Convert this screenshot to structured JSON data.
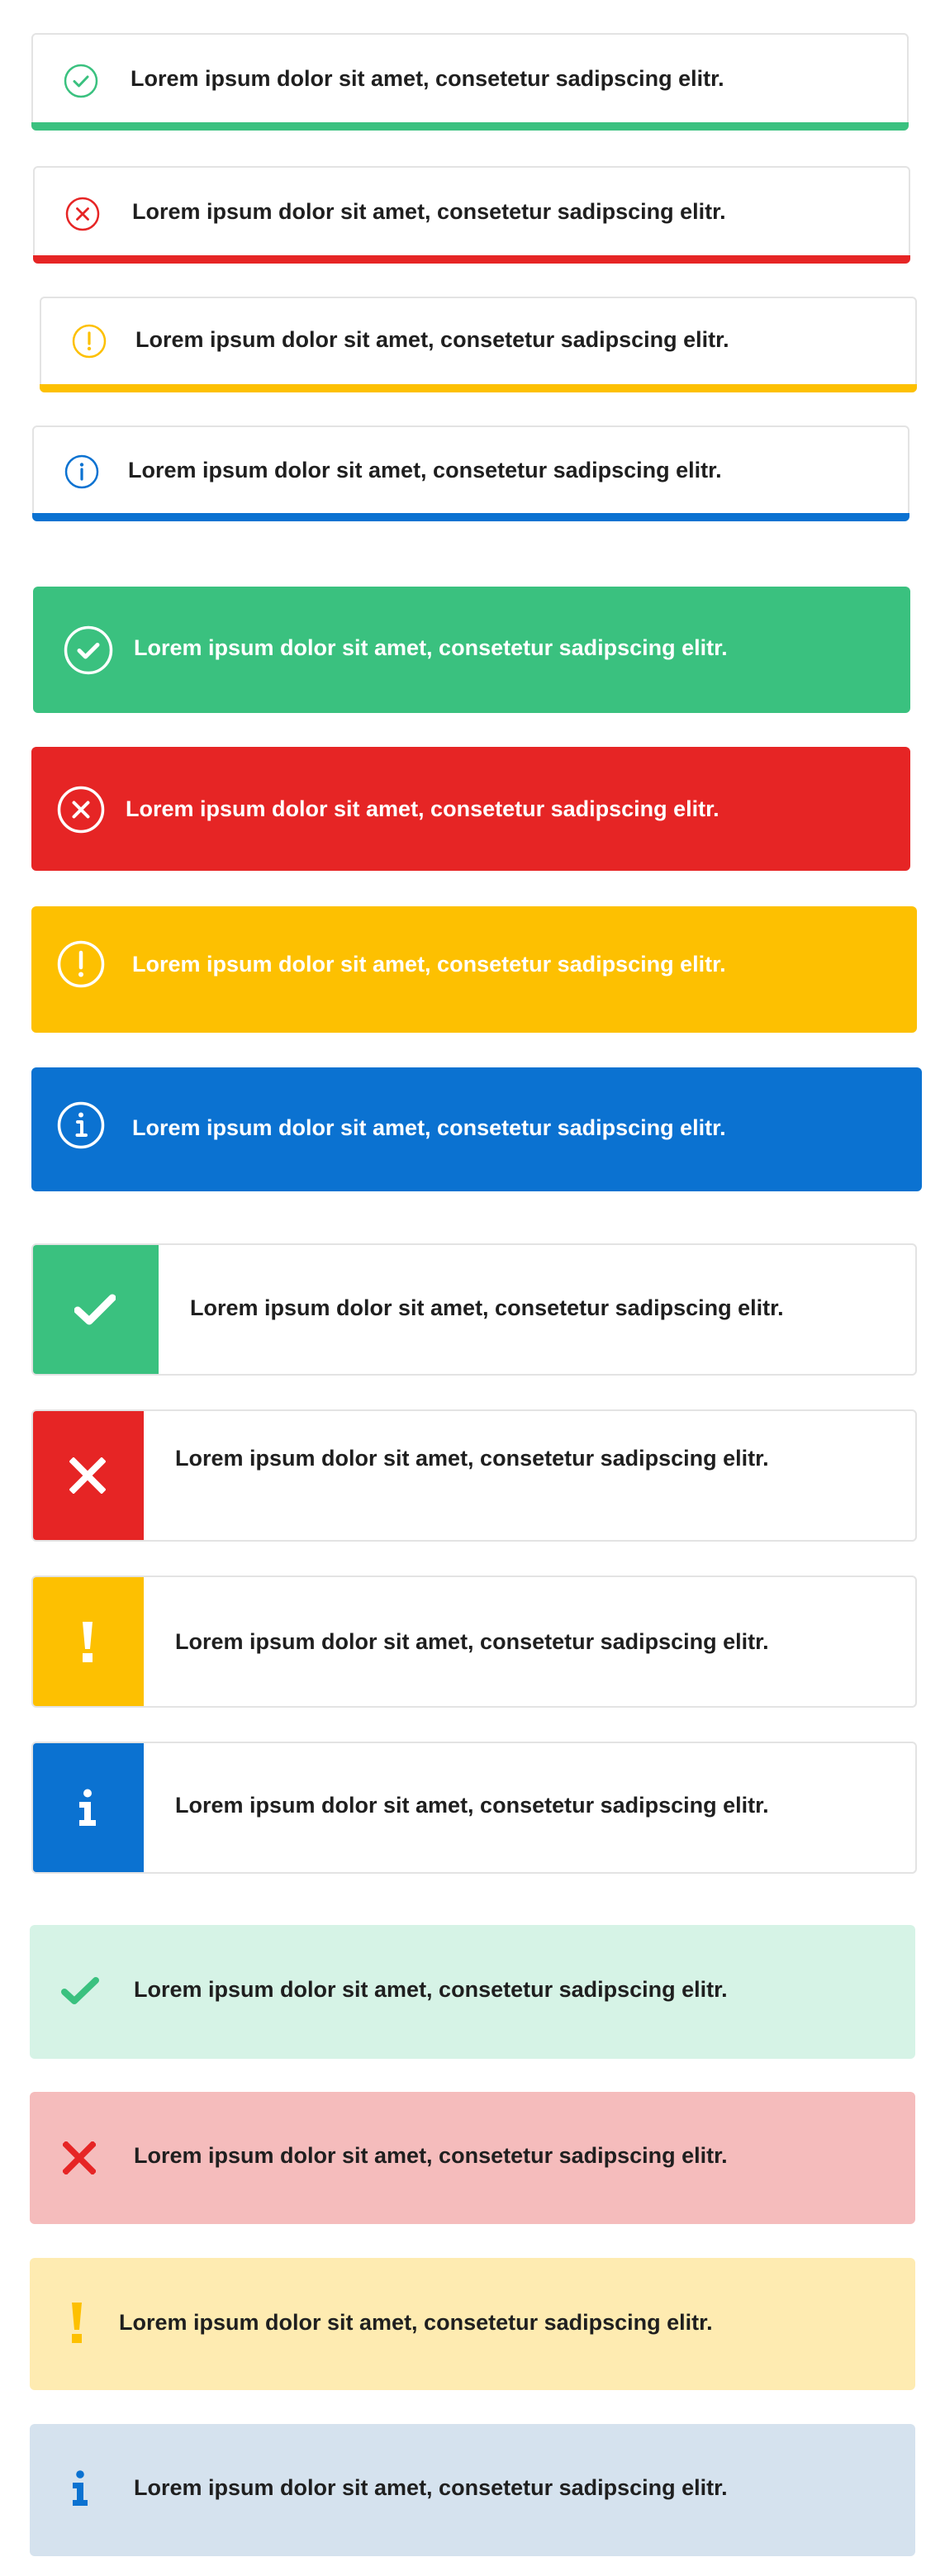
{
  "colors": {
    "success": "#3ac17f",
    "error": "#e62525",
    "warning": "#fdc001",
    "info": "#0b72d1",
    "success_pale": "#d6f3e6",
    "error_pale": "#f5bcbc",
    "warning_pale": "#feebb1",
    "info_pale": "#d5e2ee"
  },
  "outlined": [
    {
      "kind": "success",
      "icon": "check-circle-icon",
      "text": "Lorem ipsum dolor sit amet, consetetur sadipscing elitr."
    },
    {
      "kind": "error",
      "icon": "x-circle-icon",
      "text": "Lorem ipsum dolor sit amet, consetetur sadipscing elitr."
    },
    {
      "kind": "warning",
      "icon": "exclamation-circle-icon",
      "text": "Lorem ipsum dolor sit amet, consetetur sadipscing elitr."
    },
    {
      "kind": "info",
      "icon": "info-circle-icon",
      "text": "Lorem ipsum dolor sit amet, consetetur sadipscing elitr."
    }
  ],
  "solid": [
    {
      "kind": "success",
      "icon": "check-circle-icon",
      "text": "Lorem ipsum dolor sit amet, consetetur sadipscing elitr."
    },
    {
      "kind": "error",
      "icon": "x-circle-icon",
      "text": "Lorem ipsum dolor sit amet, consetetur sadipscing elitr."
    },
    {
      "kind": "warning",
      "icon": "exclamation-circle-icon",
      "text": "Lorem ipsum dolor sit amet, consetetur sadipscing elitr."
    },
    {
      "kind": "info",
      "icon": "info-circle-icon",
      "text": "Lorem ipsum dolor sit amet, consetetur sadipscing elitr."
    }
  ],
  "side_block": [
    {
      "kind": "success",
      "icon": "check-icon",
      "text": "Lorem ipsum dolor sit amet, consetetur sadipscing elitr."
    },
    {
      "kind": "error",
      "icon": "x-icon",
      "text": "Lorem ipsum dolor sit amet, consetetur sadipscing elitr."
    },
    {
      "kind": "warning",
      "icon": "exclamation-icon",
      "text": "Lorem ipsum dolor sit amet, consetetur sadipscing elitr."
    },
    {
      "kind": "info",
      "icon": "info-icon",
      "text": "Lorem ipsum dolor sit amet, consetetur sadipscing elitr."
    }
  ],
  "pale": [
    {
      "kind": "success",
      "icon": "check-icon",
      "text": "Lorem ipsum dolor sit amet, consetetur sadipscing elitr."
    },
    {
      "kind": "error",
      "icon": "x-icon",
      "text": "Lorem ipsum dolor sit amet, consetetur sadipscing elitr."
    },
    {
      "kind": "warning",
      "icon": "exclamation-icon",
      "text": "Lorem ipsum dolor sit amet, consetetur sadipscing elitr."
    },
    {
      "kind": "info",
      "icon": "info-icon",
      "text": "Lorem ipsum dolor sit amet, consetetur sadipscing elitr."
    }
  ]
}
